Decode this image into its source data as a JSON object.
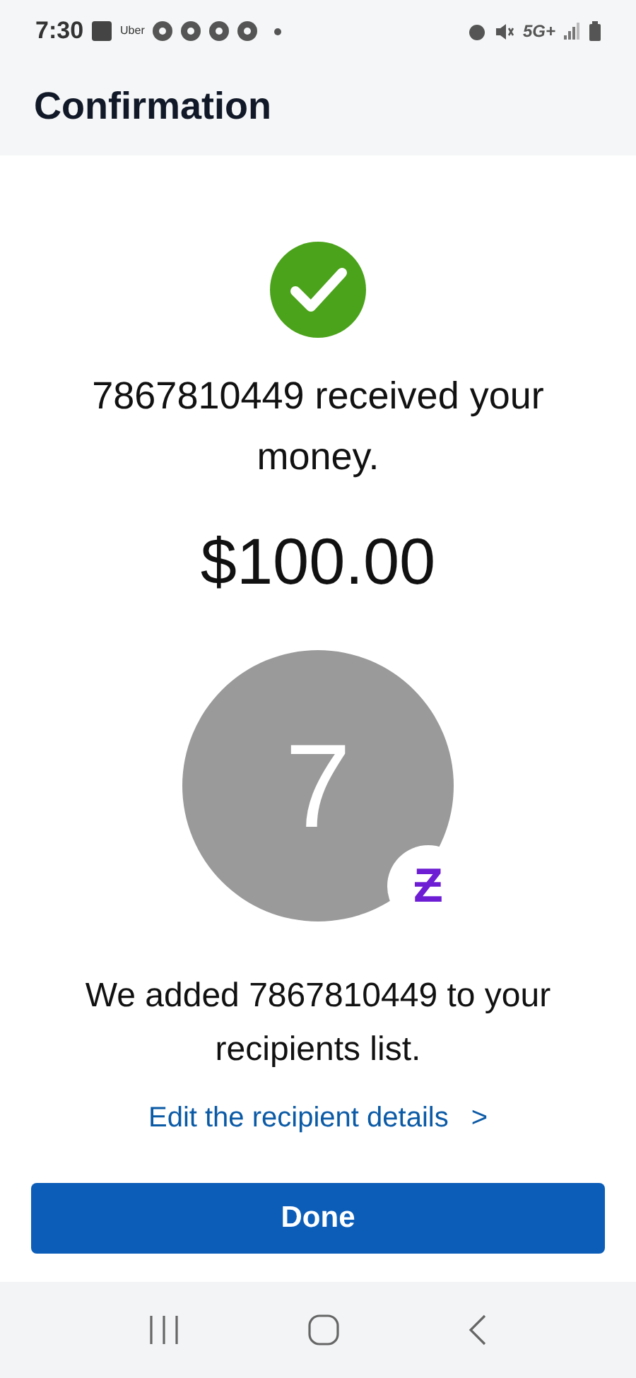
{
  "status_bar": {
    "time": "7:30",
    "uber_label": "Uber",
    "network": "5G+"
  },
  "header": {
    "title": "Confirmation"
  },
  "message": "7867810449 received your money.",
  "amount": "$100.00",
  "avatar": {
    "initial": "7",
    "badge": "Ƶ"
  },
  "note": "We added 7867810449 to your recipients list.",
  "edit_link": {
    "label": "Edit the recipient details",
    "chevron": ">"
  },
  "done_button": {
    "label": "Done"
  }
}
